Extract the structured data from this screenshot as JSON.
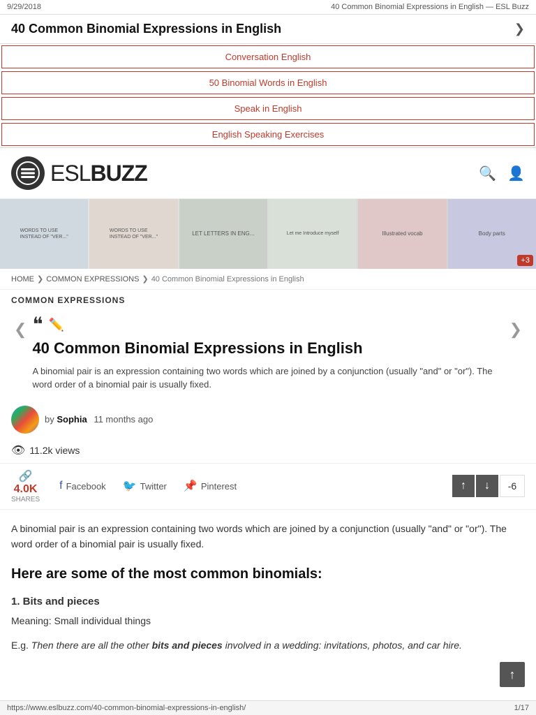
{
  "browser": {
    "date": "9/29/2018",
    "title": "40 Common Binomial Expressions in English — ESL Buzz",
    "page_indicator": "1/17",
    "url": "https://www.eslbuzz.com/40-common-binomial-expressions-in-english/"
  },
  "page_title": "40 Common Binomial Expressions in English",
  "nav_links": [
    {
      "label": "Conversation English"
    },
    {
      "label": "50 Binomial Words in English"
    },
    {
      "label": "Speak in English"
    },
    {
      "label": "English Speaking Exercises"
    }
  ],
  "logo": {
    "esl": "ESL",
    "buzz": "BUZZ"
  },
  "breadcrumb": {
    "home": "HOME",
    "sep1": "❯",
    "section": "COMMON EXPRESSIONS",
    "sep2": "❯",
    "current": "40 Common Binomial Expressions in English"
  },
  "section_label": "COMMON EXPRESSIONS",
  "article": {
    "title": "40 Common Binomial Expressions in English",
    "excerpt": "A binomial pair is an expression containing two words which are joined by a conjunction (usually \"and\" or \"or\"). The word order of a binomial pair is usually fixed.",
    "author": "Sophia",
    "time_ago": "11 months ago",
    "views": "11.2k views",
    "shares": {
      "count": "4.0K",
      "label": "SHARES"
    },
    "vote_count": "-6",
    "social": {
      "facebook": "Facebook",
      "twitter": "Twitter",
      "pinterest": "Pinterest"
    }
  },
  "body": {
    "intro": "A binomial pair is an expression containing two words which are joined by a conjunction (usually \"and\" or \"or\"). The word order of a binomial pair is usually fixed.",
    "heading1": "Here are some of the most common binomials:",
    "item1_title": "1. Bits and pieces",
    "item1_meaning": "Meaning: Small individual things",
    "item1_example": "E.g. Then there are all the other bits and pieces involved in a wedding: invitations, photos, and car hire."
  },
  "footer": {
    "url": "https://www.eslbuzz.com/40-common-binomial-expressions-in-english/",
    "page_indicator": "1/17"
  }
}
